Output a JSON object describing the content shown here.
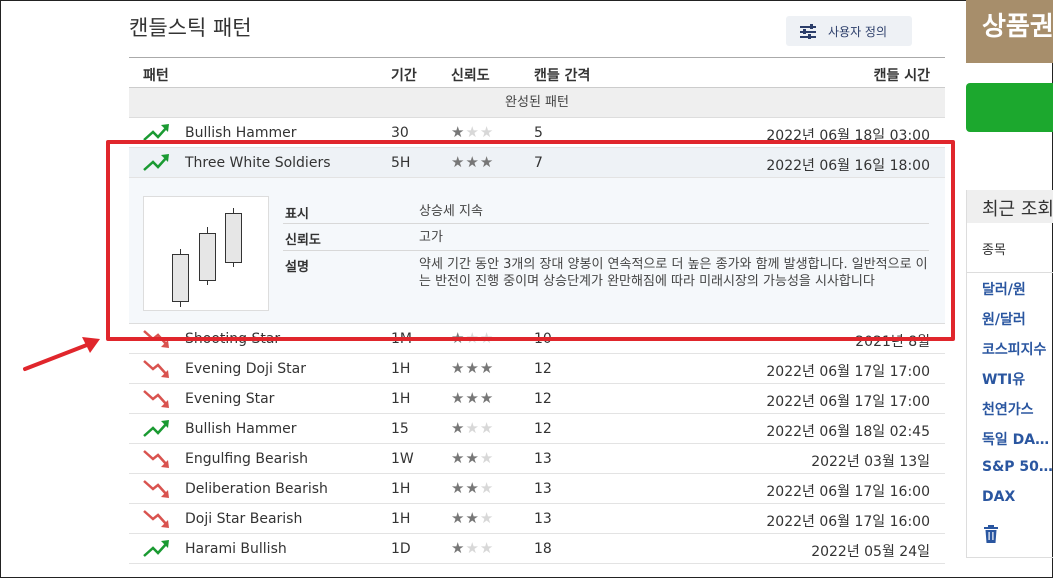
{
  "page": {
    "title": "캔들스틱 패턴"
  },
  "toolbar": {
    "custom_label": "사용자 정의"
  },
  "table": {
    "headers": {
      "pattern": "패턴",
      "period": "기간",
      "reliability": "신뢰도",
      "gap": "캔들 간격",
      "time": "캔들 시간"
    },
    "section_label": "완성된 패턴"
  },
  "rows": [
    {
      "name": "Bullish Hammer",
      "period": "30",
      "stars": 1,
      "gap": "5",
      "time": "2022년 06월 18일 03:00",
      "trend": "up"
    },
    {
      "name": "Three White Soldiers",
      "period": "5H",
      "stars": 3,
      "gap": "7",
      "time": "2022년 06월 16일 18:00",
      "trend": "up"
    },
    {
      "name": "Shooting Star",
      "period": "1M",
      "stars": 1,
      "gap": "10",
      "time": "2021년 8월",
      "trend": "down"
    },
    {
      "name": "Evening Doji Star",
      "period": "1H",
      "stars": 3,
      "gap": "12",
      "time": "2022년 06월 17일 17:00",
      "trend": "down"
    },
    {
      "name": "Evening Star",
      "period": "1H",
      "stars": 3,
      "gap": "12",
      "time": "2022년 06월 17일 17:00",
      "trend": "down"
    },
    {
      "name": "Bullish Hammer",
      "period": "15",
      "stars": 1,
      "gap": "12",
      "time": "2022년 06월 18일 02:45",
      "trend": "up"
    },
    {
      "name": "Engulfing Bearish",
      "period": "1W",
      "stars": 2,
      "gap": "13",
      "time": "2022년 03월 13일",
      "trend": "down"
    },
    {
      "name": "Deliberation Bearish",
      "period": "1H",
      "stars": 2,
      "gap": "13",
      "time": "2022년 06월 17일 16:00",
      "trend": "down"
    },
    {
      "name": "Doji Star Bearish",
      "period": "1H",
      "stars": 2,
      "gap": "13",
      "time": "2022년 06월 17일 16:00",
      "trend": "down"
    },
    {
      "name": "Harami Bullish",
      "period": "1D",
      "stars": 1,
      "gap": "18",
      "time": "2022년 05월 24일",
      "trend": "up"
    }
  ],
  "detail": {
    "display_label": "표시",
    "display_value": "상승세 지속",
    "reliability_label": "신뢰도",
    "reliability_value": "고가",
    "description_label": "설명",
    "description_value": "약세 기간 동안 3개의 장대 양봉이 연속적으로 더 높은 종가와 함께 발생합니다. 일반적으로 이는 반전이 진행 중이며 상승단계가 완만해짐에 따라 미래시장의 가능성을 시사합니다"
  },
  "sidebar": {
    "banner_text": "상품권",
    "recent_title": "최근 조회",
    "column_label": "종목",
    "items": [
      "달러/원",
      "원/달러",
      "코스피지수",
      "WTI유",
      "천연가스",
      "독일 DA…",
      "S&P 50…",
      "DAX"
    ]
  },
  "colors": {
    "up": "#1a9a32",
    "down": "#d9534f",
    "highlight": "#e0262c",
    "link": "#2a56a0"
  }
}
